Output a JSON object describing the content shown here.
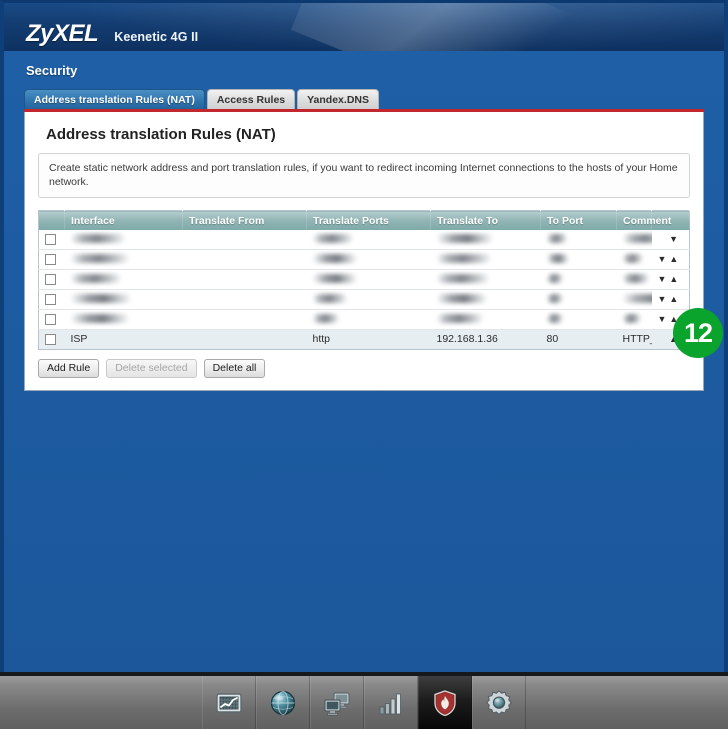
{
  "header": {
    "brand": "ZyXEL",
    "model": "Keenetic 4G II"
  },
  "section": {
    "title": "Security"
  },
  "tabs": [
    {
      "label": "Address translation Rules (NAT)",
      "active": true
    },
    {
      "label": "Access Rules",
      "active": false
    },
    {
      "label": "Yandex.DNS",
      "active": false
    }
  ],
  "panel": {
    "title": "Address translation Rules (NAT)",
    "info": "Create static network address and port translation rules, if you want to redirect incoming Internet connections to the hosts of your Home network."
  },
  "table": {
    "columns": [
      "",
      "Interface",
      "Translate From",
      "Translate Ports",
      "Translate To",
      "To Port",
      "Comment",
      ""
    ],
    "rows": [
      {
        "redacted": true,
        "interface": "",
        "translate_from": "",
        "translate_ports": "",
        "translate_to": "",
        "to_port": "",
        "comment": "",
        "arrows": [
          "down"
        ]
      },
      {
        "redacted": true,
        "interface": "",
        "translate_from": "",
        "translate_ports": "",
        "translate_to": "",
        "to_port": "",
        "comment": "",
        "arrows": [
          "down",
          "up"
        ]
      },
      {
        "redacted": true,
        "interface": "",
        "translate_from": "",
        "translate_ports": "",
        "translate_to": "",
        "to_port": "",
        "comment": "",
        "arrows": [
          "down",
          "up"
        ]
      },
      {
        "redacted": true,
        "interface": "",
        "translate_from": "",
        "translate_ports": "",
        "translate_to": "",
        "to_port": "",
        "comment": "",
        "arrows": [
          "down",
          "up"
        ]
      },
      {
        "redacted": true,
        "interface": "",
        "translate_from": "",
        "translate_ports": "",
        "translate_to": "",
        "to_port": "",
        "comment": "",
        "arrows": [
          "down",
          "up"
        ]
      },
      {
        "redacted": false,
        "interface": "ISP",
        "translate_from": "",
        "translate_ports": "http",
        "translate_to": "192.168.1.36",
        "to_port": "80",
        "comment": "HTTP_Server",
        "arrows": [
          "up"
        ]
      }
    ]
  },
  "buttons": {
    "add_rule": "Add Rule",
    "delete_selected": "Delete selected",
    "delete_all": "Delete all"
  },
  "badge": {
    "number": "12",
    "color": "#0aa32b"
  },
  "taskbar": {
    "items": [
      {
        "icon": "monitor-chart-icon",
        "active": false
      },
      {
        "icon": "globe-internet-icon",
        "active": false
      },
      {
        "icon": "network-computers-icon",
        "active": false
      },
      {
        "icon": "signal-bars-icon",
        "active": false
      },
      {
        "icon": "firewall-shield-icon",
        "active": true
      },
      {
        "icon": "gear-settings-icon",
        "active": false
      }
    ]
  },
  "colors": {
    "header_blue": "#133c71",
    "body_blue": "#1d5ca3",
    "tab_accent_red": "#c1272d",
    "table_header_teal": "#90b4b4",
    "badge_green": "#0aa32b"
  }
}
